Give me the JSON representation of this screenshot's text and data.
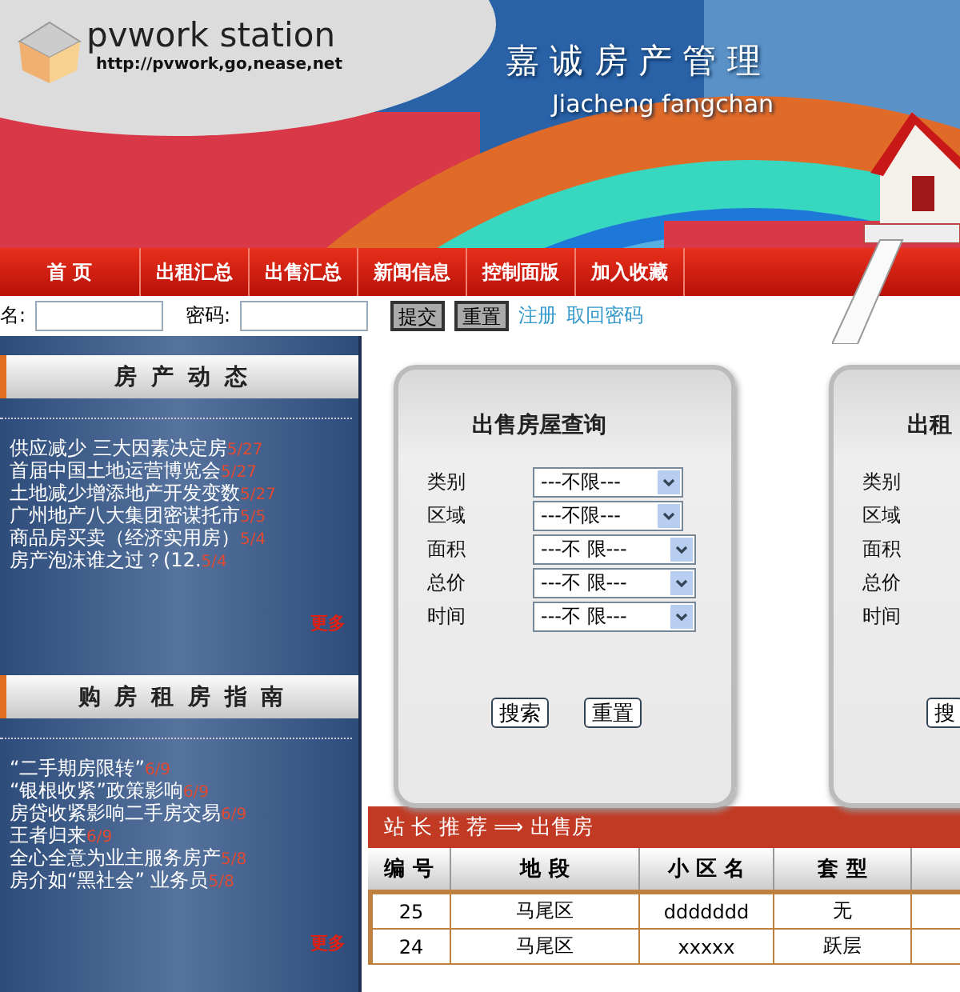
{
  "header": {
    "logo_title": "pvwork station",
    "logo_url": "http://pvwork,go,nease,net",
    "title": "嘉 诚 房 产 管 理",
    "subtitle": "Jiacheng fangchan"
  },
  "nav": [
    {
      "label": "首 页"
    },
    {
      "label": "出租汇总"
    },
    {
      "label": "出售汇总"
    },
    {
      "label": "新闻信息"
    },
    {
      "label": "控制面版"
    },
    {
      "label": "加入收藏"
    }
  ],
  "login": {
    "fields": [
      {
        "label": "名:"
      },
      {
        "label": "密码:"
      }
    ],
    "buttons": [
      "提交",
      "重置"
    ],
    "links": [
      "注册",
      "取回密码"
    ]
  },
  "sidebar": [
    {
      "title": "房 产 动 态",
      "more": "更多",
      "items": [
        {
          "text": "供应减少  三大因素决定房",
          "date": "5/27"
        },
        {
          "text": "首届中国土地运营博览会",
          "date": "5/27"
        },
        {
          "text": "土地减少增添地产开发变数",
          "date": "5/27"
        },
        {
          "text": "广州地产八大集团密谋托市",
          "date": "5/5"
        },
        {
          "text": "商品房买卖（经济实用房）",
          "date": "5/4"
        },
        {
          "text": "房产泡沫谁之过？(12.",
          "date": "5/4"
        }
      ]
    },
    {
      "title": "购 房 租 房 指 南",
      "more": "更多",
      "items": [
        {
          "text": " “二手期房限转”",
          "date": "6/9"
        },
        {
          "text": " “银根收紧”政策影响",
          "date": "6/9"
        },
        {
          "text": "房贷收紧影响二手房交易",
          "date": "6/9"
        },
        {
          "text": "王者归来",
          "date": "6/9"
        },
        {
          "text": "全心全意为业主服务房产",
          "date": "5/8"
        },
        {
          "text": "房介如“黑社会” 业务员",
          "date": "5/8"
        }
      ]
    }
  ],
  "search_panels": [
    {
      "title": "出售房屋查询",
      "fields": [
        {
          "label": "类别",
          "value": "---不限---"
        },
        {
          "label": "区域",
          "value": "---不限---"
        },
        {
          "label": "面积",
          "value": "---不 限---"
        },
        {
          "label": "总价",
          "value": "---不 限---"
        },
        {
          "label": "时间",
          "value": "---不 限---"
        }
      ],
      "buttons": [
        "搜索",
        "重置"
      ]
    },
    {
      "title": "出租",
      "fields": [
        {
          "label": "类别"
        },
        {
          "label": "区域"
        },
        {
          "label": "面积"
        },
        {
          "label": "总价"
        },
        {
          "label": "时间"
        }
      ],
      "buttons": [
        "搜"
      ]
    }
  ],
  "table": {
    "title": "站 长 推 荐 ⟹ 出售房",
    "columns": [
      "编 号",
      "地 段",
      "小 区 名",
      "套 型"
    ],
    "rows": [
      [
        "25",
        "马尾区",
        "ddddddd",
        "无"
      ],
      [
        "24",
        "马尾区",
        "xxxxx",
        "跃层"
      ]
    ]
  }
}
